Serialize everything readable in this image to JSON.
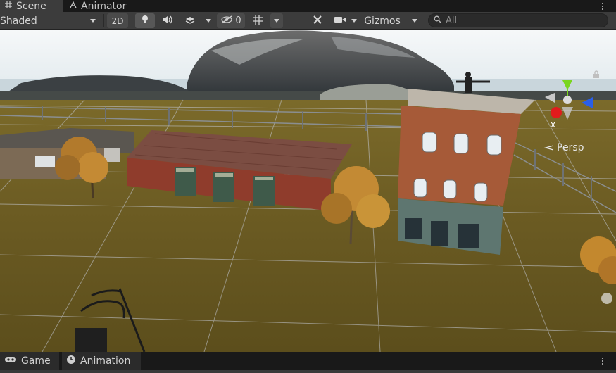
{
  "top_tabs": [
    {
      "label": "Scene",
      "icon": "grid-icon",
      "active": true
    },
    {
      "label": "Animator",
      "icon": "animator-icon",
      "active": false
    }
  ],
  "toolbar": {
    "shading_mode": "Shaded",
    "mode_2d_label": "2D",
    "hidden_count": "0",
    "gizmos_label": "Gizmos",
    "search_placeholder": "All"
  },
  "viewport": {
    "projection_label": "Persp",
    "axis_x_label": "x",
    "colors": {
      "sky": "#e8f0f4",
      "ground": "#6b5d22",
      "grid": "#c8ccd8",
      "brick": "#9c4a32",
      "roof": "#7b4a3a",
      "tree": "#c8882a",
      "axis_x": "#e01c1c",
      "axis_y": "#7ad61e",
      "axis_z": "#2a5fe8"
    }
  },
  "bottom_tabs": [
    {
      "label": "Game",
      "icon": "gamepad-icon"
    },
    {
      "label": "Animation",
      "icon": "clock-icon"
    }
  ]
}
